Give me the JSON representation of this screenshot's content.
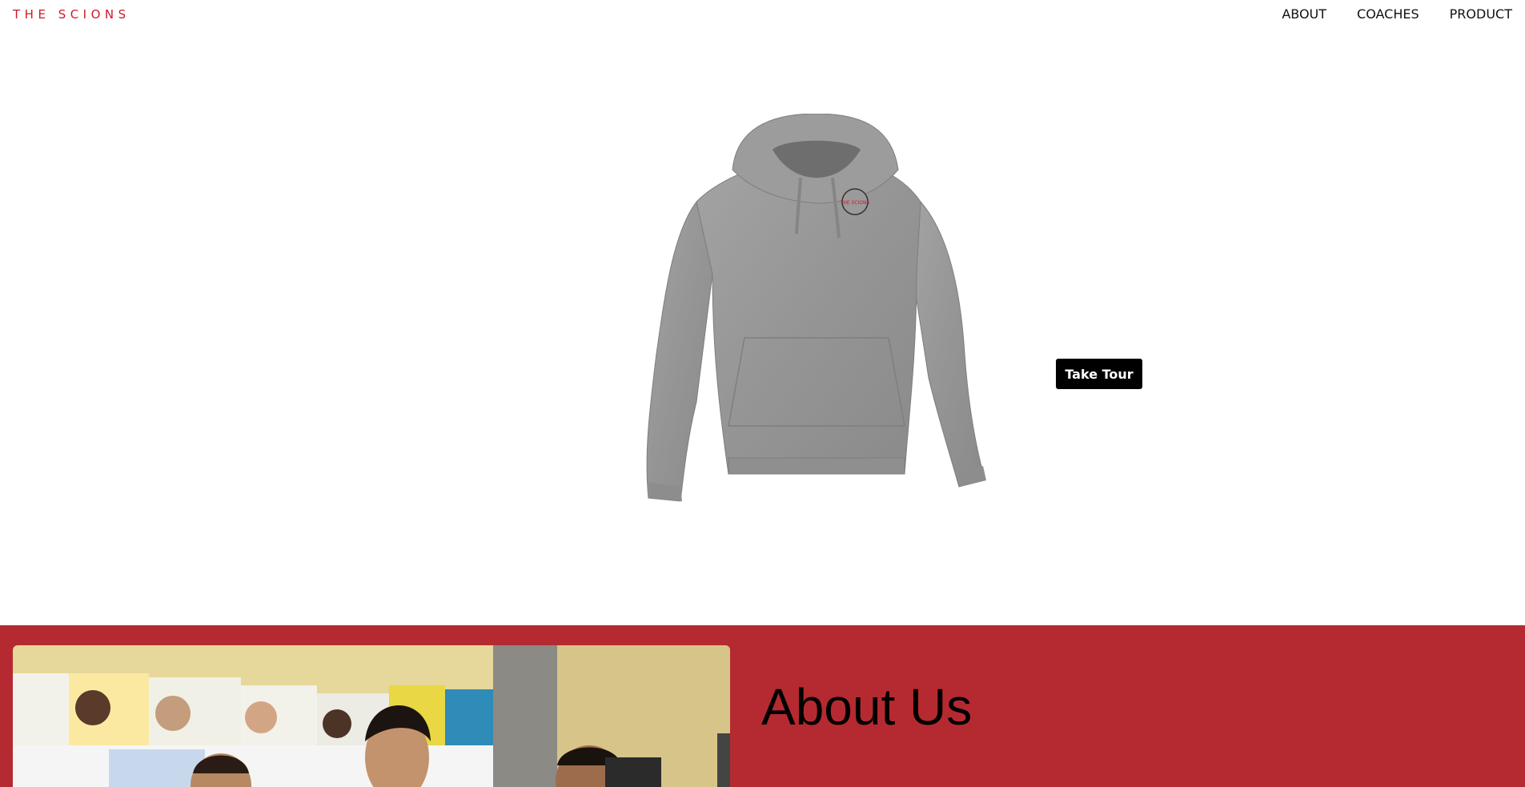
{
  "brand": "THE SCIONS",
  "nav": {
    "items": [
      "ABOUT",
      "COACHES",
      "PRODUCT"
    ]
  },
  "hero": {
    "image": "gray-hoodie-with-scions-logo",
    "logo_text": "THE SCIONS",
    "button_label": "Take Tour"
  },
  "about": {
    "title": "About Us",
    "image": "students-in-classroom-photo"
  },
  "colors": {
    "brand_red": "#d0182a",
    "section_red": "#b52a30",
    "button_bg": "#000000"
  }
}
